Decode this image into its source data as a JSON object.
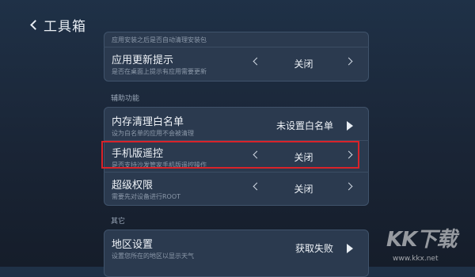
{
  "header": {
    "title": "工具箱"
  },
  "partial_top": {
    "desc": "应用安装之后是否自动清理安装包"
  },
  "rows_top": [
    {
      "title": "应用更新提示",
      "desc": "是否在桌面上提示有应用需要更新",
      "value": "关闭"
    }
  ],
  "section_assist": {
    "label": "辅助功能"
  },
  "rows_assist": [
    {
      "title": "内存清理白名单",
      "desc": "设为白名单的应用不会被清理",
      "value": "未设置白名单"
    },
    {
      "title": "手机版遥控",
      "desc": "是否支持沙发管家手机版遥控操作",
      "value": "关闭"
    },
    {
      "title": "超级权限",
      "desc": "需要先对设备进行ROOT",
      "value": "关闭"
    }
  ],
  "section_other": {
    "label": "其它"
  },
  "rows_other": [
    {
      "title": "地区设置",
      "desc": "设置您所在的地区以显示天气",
      "value": "获取失败"
    }
  ],
  "watermark": {
    "logo": "KK下载",
    "url": "www.kkx.net"
  },
  "colors": {
    "highlight": "#d8232a",
    "card": "#2b3a4f",
    "background": "#1a2536"
  }
}
